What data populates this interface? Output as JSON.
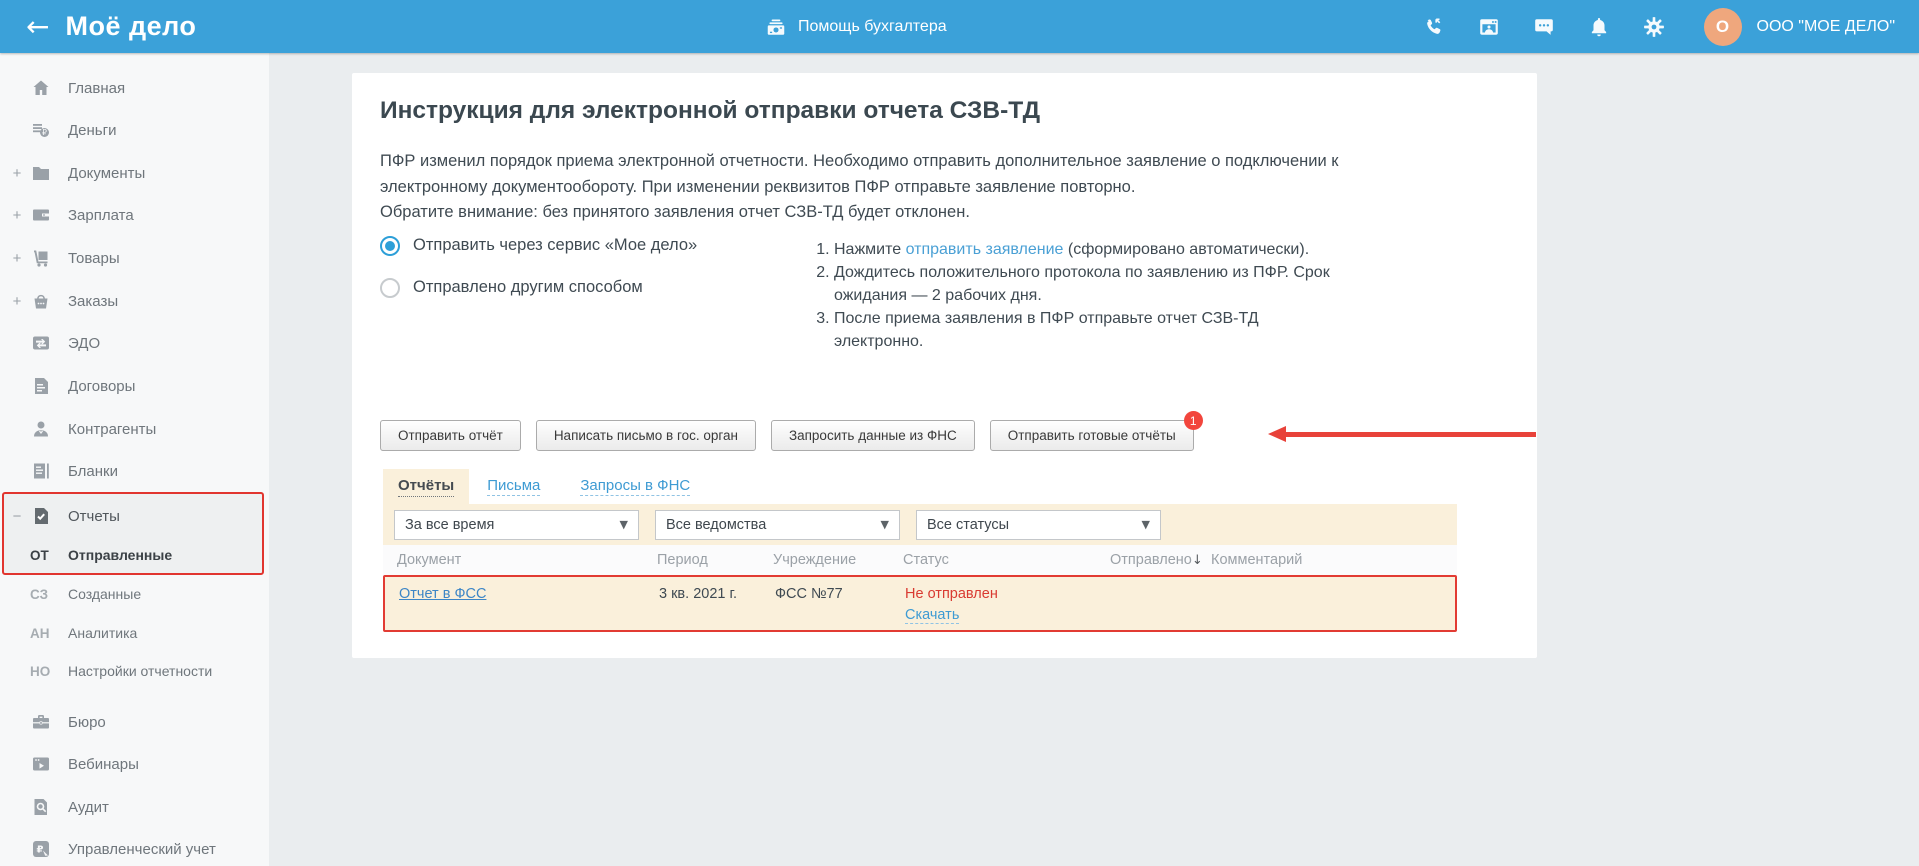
{
  "header": {
    "logo": "Моё дело",
    "help_label": "Помощь бухгалтера",
    "org_initial": "О",
    "org_name": "ООО \"МОЕ ДЕЛО\""
  },
  "sidebar": {
    "items": [
      {
        "label": "Главная"
      },
      {
        "label": "Деньги"
      },
      {
        "label": "Документы",
        "expand": "+"
      },
      {
        "label": "Зарплата",
        "expand": "+"
      },
      {
        "label": "Товары",
        "expand": "+"
      },
      {
        "label": "Заказы",
        "expand": "+"
      },
      {
        "label": "ЭДО"
      },
      {
        "label": "Договоры"
      },
      {
        "label": "Контрагенты"
      },
      {
        "label": "Бланки"
      },
      {
        "label": "Отчеты",
        "expand": "−"
      },
      {
        "label": "Отправленные",
        "prefix": "ОТ"
      },
      {
        "label": "Созданные",
        "prefix": "СЗ"
      },
      {
        "label": "Аналитика",
        "prefix": "АН"
      },
      {
        "label": "Настройки отчетности",
        "prefix": "НО"
      },
      {
        "label": "Бюро"
      },
      {
        "label": "Вебинары"
      },
      {
        "label": "Аудит"
      },
      {
        "label": "Управленческий учет"
      }
    ]
  },
  "main": {
    "title": "Инструкция для электронной отправки отчета СЗВ-ТД",
    "intro": {
      "line1": "ПФР изменил порядок приема электронной отчетности. Необходимо отправить дополнительное заявление о подключении к",
      "line2": "электронному документообороту. При изменении реквизитов ПФР отправьте заявление повторно.",
      "line3": "Обратите внимание: без принятого заявления отчет СЗВ-ТД будет отклонен."
    },
    "send_options": [
      {
        "label": "Отправить через сервис «Мое дело»",
        "selected": true
      },
      {
        "label": "Отправлено другим способом",
        "selected": false
      }
    ],
    "steps": {
      "step1_pre": "Нажмите ",
      "step1_link": "отправить заявление",
      "step1_post": " (сформировано автоматически).",
      "step2": "Дождитесь положительного протокола по заявлению из ПФР. Срок ожидания — 2 рабочих дня.",
      "step3": "После приема заявления в ПФР отправьте отчет СЗВ-ТД электронно."
    },
    "buttons": {
      "send_report": "Отправить отчёт",
      "write_letter": "Написать письмо в гос. орган",
      "request_fns": "Запросить данные из ФНС",
      "send_ready": "Отправить готовые отчёты",
      "send_ready_badge": "1"
    },
    "tabs": [
      {
        "label": "Отчёты",
        "active": true
      },
      {
        "label": "Письма",
        "active": false
      },
      {
        "label": "Запросы в ФНС",
        "active": false
      }
    ],
    "filters": [
      {
        "value": "За все время"
      },
      {
        "value": "Все ведомства"
      },
      {
        "value": "Все статусы"
      }
    ],
    "filter_arrow": "▼",
    "table": {
      "columns": [
        "Документ",
        "Период",
        "Учреждение",
        "Статус",
        "Отправлено",
        "Комментарий"
      ],
      "sort_arrow": "↓",
      "row": {
        "document": "Отчет в ФСС",
        "period": "3 кв. 2021 г.",
        "institution": "ФСС №77",
        "status": "Не отправлен",
        "status_link": "Скачать",
        "sent": "",
        "comment": ""
      }
    }
  },
  "colors": {
    "header_blue": "#3ba1d9",
    "accent_red": "#e23b33",
    "cream": "#faf0db",
    "link_blue": "#3e9bd3",
    "avatar_orange": "#efa77d"
  }
}
